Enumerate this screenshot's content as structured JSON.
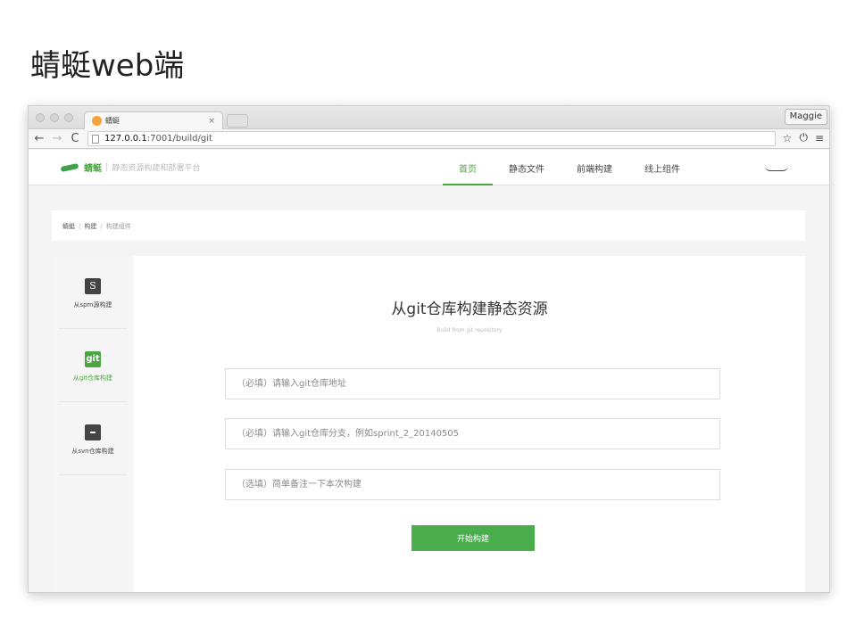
{
  "slide": {
    "title": "蜻蜓web端"
  },
  "browser": {
    "tab_title": "蜻蜓",
    "tab_close": "×",
    "user_button": "Maggie",
    "back_icon": "←",
    "forward_icon": "→",
    "reload_icon": "C",
    "url_host": "127.0.0.1",
    "url_path": ":7001/build/git",
    "star_icon": "☆",
    "power_icon": "⏻",
    "menu_icon": "≡"
  },
  "header": {
    "logo_name": "蜻蜓",
    "logo_sep": "|",
    "logo_slogan": "静态资源构建和部署平台",
    "nav": [
      {
        "label": "首页",
        "active": true
      },
      {
        "label": "静态文件",
        "active": false
      },
      {
        "label": "前端构建",
        "active": false
      },
      {
        "label": "线上组件",
        "active": false
      }
    ]
  },
  "breadcrumb": {
    "items": [
      "蜻蜓",
      "构建",
      "构建组件"
    ],
    "sep1": "|",
    "sep2": "/"
  },
  "sidebar": {
    "items": [
      {
        "icon_text": "S",
        "label": "从spm源构建",
        "active": false
      },
      {
        "icon_text": "git",
        "label": "从git仓库构建",
        "active": true
      },
      {
        "icon_text": "",
        "label": "从svn仓库构建",
        "active": false
      }
    ]
  },
  "form": {
    "title": "从git仓库构建静态资源",
    "subtitle": "Build from git repository",
    "repo_placeholder": "（必填）请输入git仓库地址",
    "branch_placeholder": "（必填）请输入git仓库分支，例如sprint_2_20140505",
    "note_placeholder": "（选填）简单备注一下本次构建",
    "submit_label": "开始构建"
  },
  "colors": {
    "accent": "#4aa63f",
    "button": "#4aae4e"
  }
}
